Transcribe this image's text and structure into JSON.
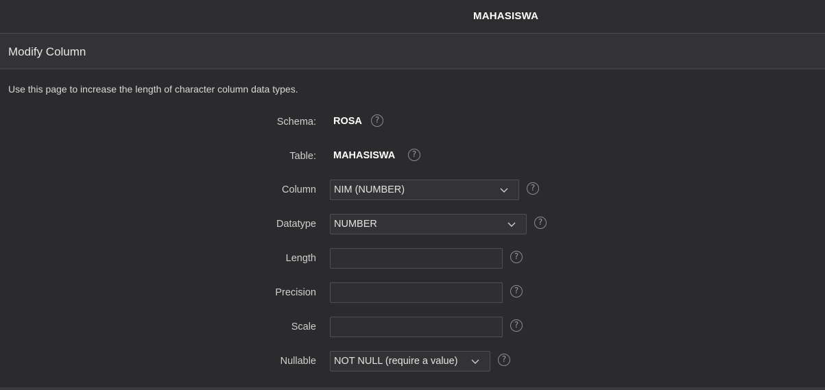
{
  "topbar": {
    "title": "MAHASISWA"
  },
  "section": {
    "heading": "Modify Column"
  },
  "intro": "Use this page to increase the length of character column data types.",
  "form": {
    "schema": {
      "label": "Schema:",
      "value": "ROSA",
      "help": "?"
    },
    "table": {
      "label": "Table:",
      "value": "MAHASISWA",
      "help": "?"
    },
    "column": {
      "label": "Column",
      "selected": "NIM (NUMBER)",
      "help": "?"
    },
    "datatype": {
      "label": "Datatype",
      "selected": "NUMBER",
      "help": "?"
    },
    "length": {
      "label": "Length",
      "value": "",
      "help": "?"
    },
    "precision": {
      "label": "Precision",
      "value": "",
      "help": "?"
    },
    "scale": {
      "label": "Scale",
      "value": "",
      "help": "?"
    },
    "nullable": {
      "label": "Nullable",
      "selected": "NOT NULL (require a value)",
      "help": "?"
    }
  },
  "icons": {
    "help": "help-circle-icon",
    "dropdown": "chevron-down-icon"
  },
  "colors": {
    "background": "#2b2b2d",
    "border": "#4a4a4c",
    "text": "#e2e2e2"
  }
}
